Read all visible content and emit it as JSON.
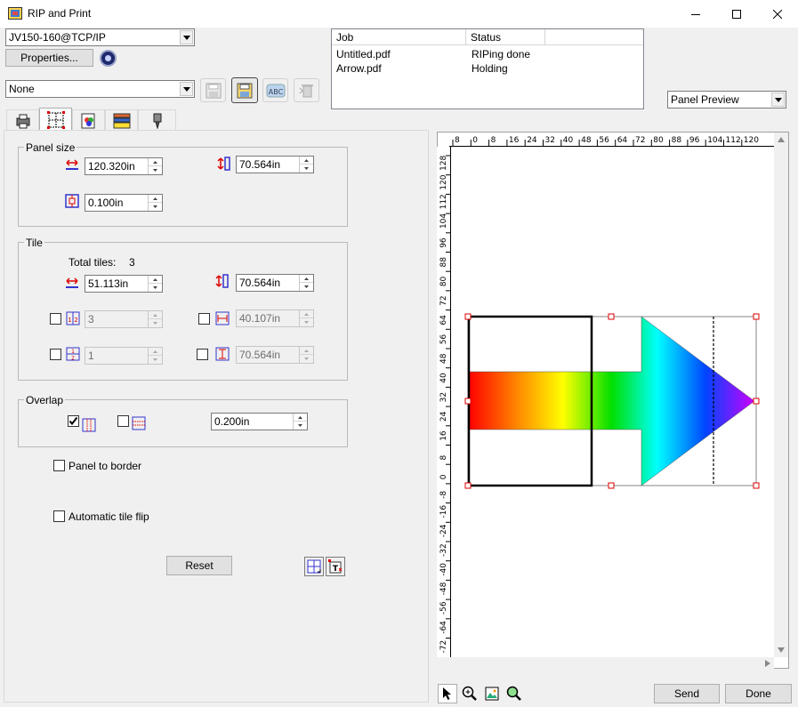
{
  "window": {
    "title": "RIP and Print"
  },
  "printer": {
    "selected": "JV150-160@TCP/IP",
    "properties_label": "Properties..."
  },
  "queue": {
    "selected": "None"
  },
  "jobs": {
    "columns": [
      "Job",
      "Status"
    ],
    "rows": [
      {
        "job": "Untitled.pdf",
        "status": "RIPing done"
      },
      {
        "job": "Arrow.pdf",
        "status": "Holding"
      }
    ]
  },
  "view_mode": {
    "selected": "Panel Preview"
  },
  "panel_size": {
    "label": "Panel size",
    "width": "120.320in",
    "height": "70.564in",
    "margin": "0.100in"
  },
  "tile": {
    "label": "Tile",
    "total_tiles_label": "Total tiles:",
    "total_tiles": "3",
    "width": "51.113in",
    "height": "70.564in",
    "columns": "3",
    "col_width": "40.107in",
    "rows": "1",
    "row_height": "70.564in"
  },
  "overlap": {
    "label": "Overlap",
    "value": "0.200in",
    "horizontal_checked": true,
    "vertical_checked": false
  },
  "options": {
    "panel_to_border": "Panel to border",
    "automatic_tile_flip": "Automatic tile flip"
  },
  "reset_label": "Reset",
  "ruler": {
    "h_ticks": [
      "8",
      "0",
      "8",
      "16",
      "24",
      "32",
      "40",
      "48",
      "56",
      "64",
      "72",
      "80",
      "88",
      "96",
      "104",
      "112",
      "120"
    ],
    "v_ticks": [
      "128",
      "120",
      "112",
      "104",
      "96",
      "88",
      "80",
      "72",
      "64",
      "56",
      "48",
      "40",
      "32",
      "24",
      "16",
      "8",
      "0",
      "-8",
      "-16",
      "-24",
      "-32",
      "-40",
      "-48",
      "-56",
      "-64",
      "-72"
    ]
  },
  "footer": {
    "send_label": "Send",
    "done_label": "Done"
  },
  "icons": {
    "app": "rip-app-icon",
    "save": "save-icon",
    "save_as": "save-as-icon",
    "spell": "abc-icon",
    "delete": "trash-icon"
  }
}
